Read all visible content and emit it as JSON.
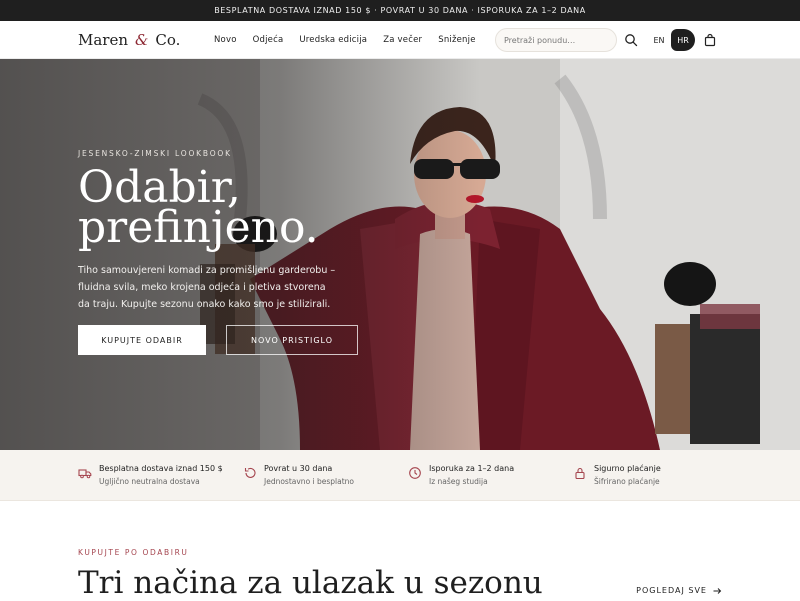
{
  "announcement": "BESPLATNA DOSTAVA IZNAD 150 $ · POVRAT U 30 DANA · ISPORUKA ZA 1–2 DANA",
  "header": {
    "logo_left": "Maren",
    "logo_amp": "&",
    "logo_right": "Co.",
    "nav": [
      "Novo",
      "Odjeća",
      "Uredska edicija",
      "Za večer",
      "Sniženje"
    ],
    "search_placeholder": "Pretraži ponudu…",
    "lang_en": "EN",
    "lang_hr": "HR"
  },
  "hero": {
    "eyebrow": "JESENSKO-ZIMSKI LOOKBOOK",
    "title_line1": "Odabir,",
    "title_line2": "prefinjeno.",
    "text": "Tiho samouvjereni komadi za promišljenu garderobu – fluidna svila, meko krojena odjeća i pletiva stvorena da traju. Kupujte sezonu onako kako smo je stilizirali.",
    "primary_button": "KUPUJTE ODABIR",
    "secondary_button": "NOVO PRISTIGLO"
  },
  "features": [
    {
      "title": "Besplatna dostava iznad 150 $",
      "subtitle": "Ugljično neutralna dostava",
      "icon": "truck-icon"
    },
    {
      "title": "Povrat u 30 dana",
      "subtitle": "Jednostavno i besplatno",
      "icon": "return-icon"
    },
    {
      "title": "Isporuka za 1–2 dana",
      "subtitle": "Iz našeg studija",
      "icon": "clock-icon"
    },
    {
      "title": "Sigurno plaćanje",
      "subtitle": "Šifrirano plaćanje",
      "icon": "lock-icon"
    }
  ],
  "collections": {
    "eyebrow": "KUPUJTE PO ODABIRU",
    "title": "Tri načina za ulazak u sezonu",
    "view_all": "POGLEDAJ SVE"
  },
  "colors": {
    "accent": "#a5454f",
    "dark": "#1f1f1f",
    "strip": "#f6f3ef"
  }
}
